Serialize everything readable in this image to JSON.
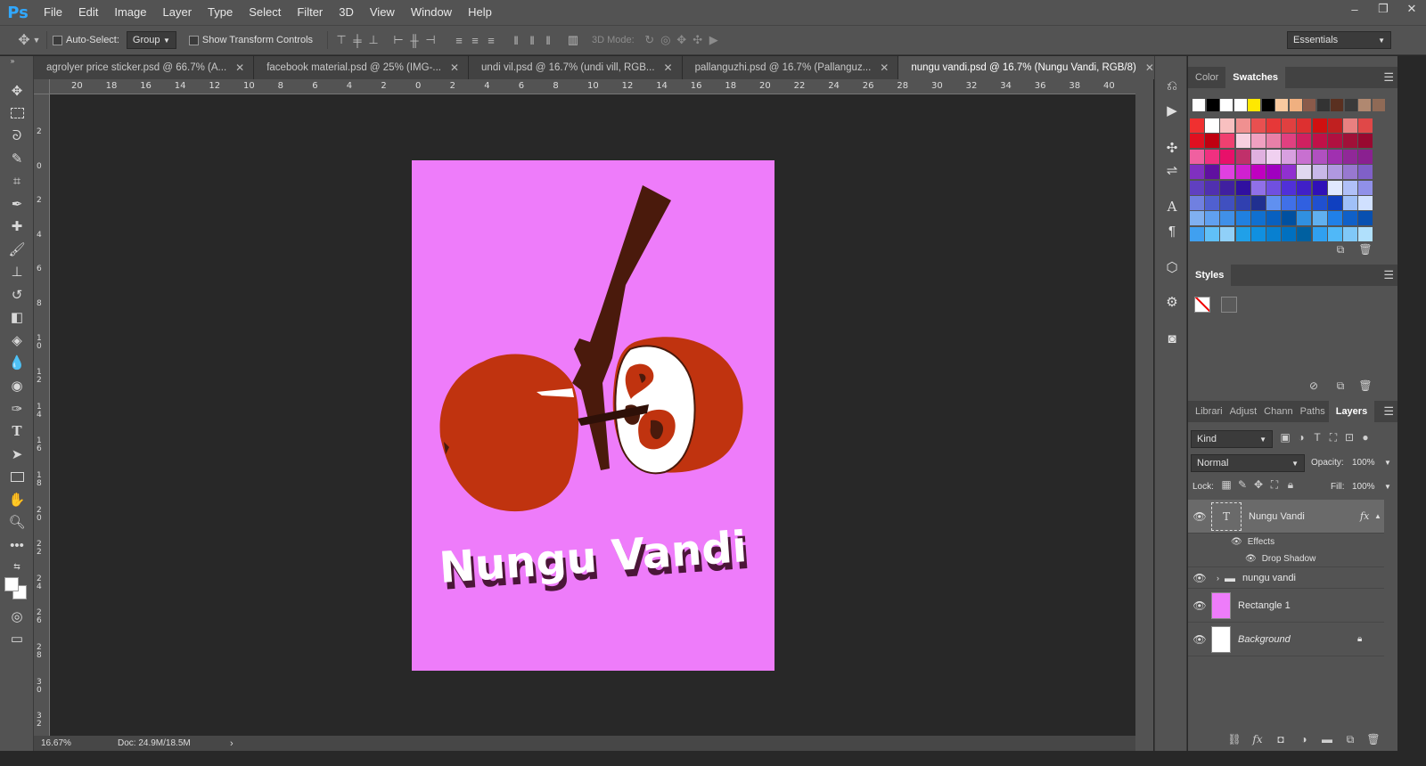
{
  "app": {
    "logo": "Ps"
  },
  "menu": [
    "File",
    "Edit",
    "Image",
    "Layer",
    "Type",
    "Select",
    "Filter",
    "3D",
    "View",
    "Window",
    "Help"
  ],
  "window_controls": {
    "minimize": "–",
    "restore": "❐",
    "close": "✕"
  },
  "options": {
    "auto_select_label": "Auto-Select:",
    "auto_select_value": "Group",
    "show_transform_label": "Show Transform Controls",
    "mode_3d_label": "3D Mode:",
    "workspace": "Essentials"
  },
  "tabs": [
    {
      "label": "agrolyer price sticker.psd @ 66.7% (A...",
      "active": false
    },
    {
      "label": "facebook material.psd @ 25% (IMG-...",
      "active": false
    },
    {
      "label": "undi vil.psd @ 16.7% (undi vill, RGB...",
      "active": false
    },
    {
      "label": "pallanguzhi.psd @ 16.7% (Pallanguz...",
      "active": false
    },
    {
      "label": "nungu vandi.psd @ 16.7% (Nungu Vandi, RGB/8)",
      "active": true
    }
  ],
  "ruler_h": [
    "20",
    "18",
    "16",
    "14",
    "12",
    "10",
    "8",
    "6",
    "4",
    "2",
    "0",
    "2",
    "4",
    "6",
    "8",
    "10",
    "12",
    "14",
    "16",
    "18",
    "20",
    "22",
    "24",
    "26",
    "28",
    "30",
    "32",
    "34",
    "36",
    "38",
    "40"
  ],
  "ruler_v": [
    "2",
    "0",
    "2",
    "4",
    "6",
    "8",
    "10",
    "12",
    "14",
    "16",
    "18",
    "20",
    "22",
    "24",
    "26",
    "28",
    "30",
    "32"
  ],
  "artwork": {
    "title": "Nungu Vandi",
    "bg_color": "#ee7cfa",
    "fruit_color": "#c0330f",
    "stick_color": "#4a1a0c",
    "text_shadow": "#4b1638"
  },
  "status": {
    "zoom": "16.67%",
    "doc": "Doc: 24.9M/18.5M",
    "arrow": "›"
  },
  "panels": {
    "color_tabs": [
      "Color",
      "Swatches"
    ],
    "styles_tab": "Styles",
    "layer_tabs": [
      "Librari",
      "Adjust",
      "Chann",
      "Paths",
      "Layers"
    ],
    "kind": "Kind",
    "blend": "Normal",
    "opacity_label": "Opacity:",
    "opacity": "100%",
    "lock_label": "Lock:",
    "fill_label": "Fill:",
    "fill": "100%",
    "fx": "fx"
  },
  "layers": [
    {
      "name": "Nungu Vandi",
      "type": "text",
      "selected": true
    },
    {
      "name": "Effects",
      "type": "effects"
    },
    {
      "name": "Drop Shadow",
      "type": "effect"
    },
    {
      "name": "nungu vandi",
      "type": "group"
    },
    {
      "name": "Rectangle 1",
      "type": "shape"
    },
    {
      "name": "Background",
      "type": "background",
      "locked": true
    }
  ],
  "swatch_colors": {
    "row0": [
      "#ffffff",
      "#000000",
      "#ffffff",
      "#ffffff",
      "#ffe800",
      "#000000",
      "#f9c99f",
      "#f0b080",
      "#8a5a4a",
      "#333333",
      "#5a3020",
      "#3a3a3a",
      "#b08870",
      "#8f6a56"
    ],
    "grid": [
      [
        "#f03030",
        "#ffffff",
        "#f8c0c0",
        "#f09090",
        "#e85050",
        "#e63838",
        "#e04040",
        "#dd3030",
        "#d01010",
        "#c02020",
        "#e88080",
        "#e04848"
      ],
      [
        "#e01020",
        "#c00010",
        "#f04070",
        "#f8d0e0",
        "#f0a0c0",
        "#e880a8",
        "#e04080",
        "#d02060",
        "#c01048",
        "#b01040",
        "#a01038",
        "#980830"
      ],
      [
        "#f060a0",
        "#f03080",
        "#e8106a",
        "#c0306a",
        "#e0b0e0",
        "#f0d0f0",
        "#d8a0e0",
        "#c870d0",
        "#b050c0",
        "#a030b0",
        "#902898",
        "#8a2090"
      ],
      [
        "#8030c0",
        "#6010a0",
        "#e040e0",
        "#d020d0",
        "#c000c0",
        "#a000c0",
        "#9030d0",
        "#e0d8f0",
        "#c8b8e8",
        "#b098e0",
        "#9878d0",
        "#8060c8"
      ],
      [
        "#6040c0",
        "#5030b0",
        "#4020a0",
        "#3010a0",
        "#9070e8",
        "#7050e0",
        "#5030d8",
        "#4020c8",
        "#3010b8",
        "#e0e8ff",
        "#b0c0f8",
        "#9090e8"
      ],
      [
        "#7080e0",
        "#5060d0",
        "#4050c0",
        "#3040b0",
        "#203090",
        "#6090f0",
        "#4070e8",
        "#3060e0",
        "#2050d0",
        "#1040c0",
        "#a0c0f8",
        "#d0e0ff"
      ],
      [
        "#80b0f0",
        "#60a0f0",
        "#4090e8",
        "#2080e0",
        "#1070d0",
        "#0860c0",
        "#0050a0",
        "#3090e0",
        "#60b0f0",
        "#2080e8",
        "#1060c8",
        "#0850b0"
      ],
      [
        "#40a0f0",
        "#60c0f8",
        "#90d0f8",
        "#20a0e8",
        "#1090e0",
        "#0880d0",
        "#0070c0",
        "#0060a0",
        "#30a0f0",
        "#50b8f8",
        "#80c8f8",
        "#b0e0fc"
      ]
    ]
  }
}
